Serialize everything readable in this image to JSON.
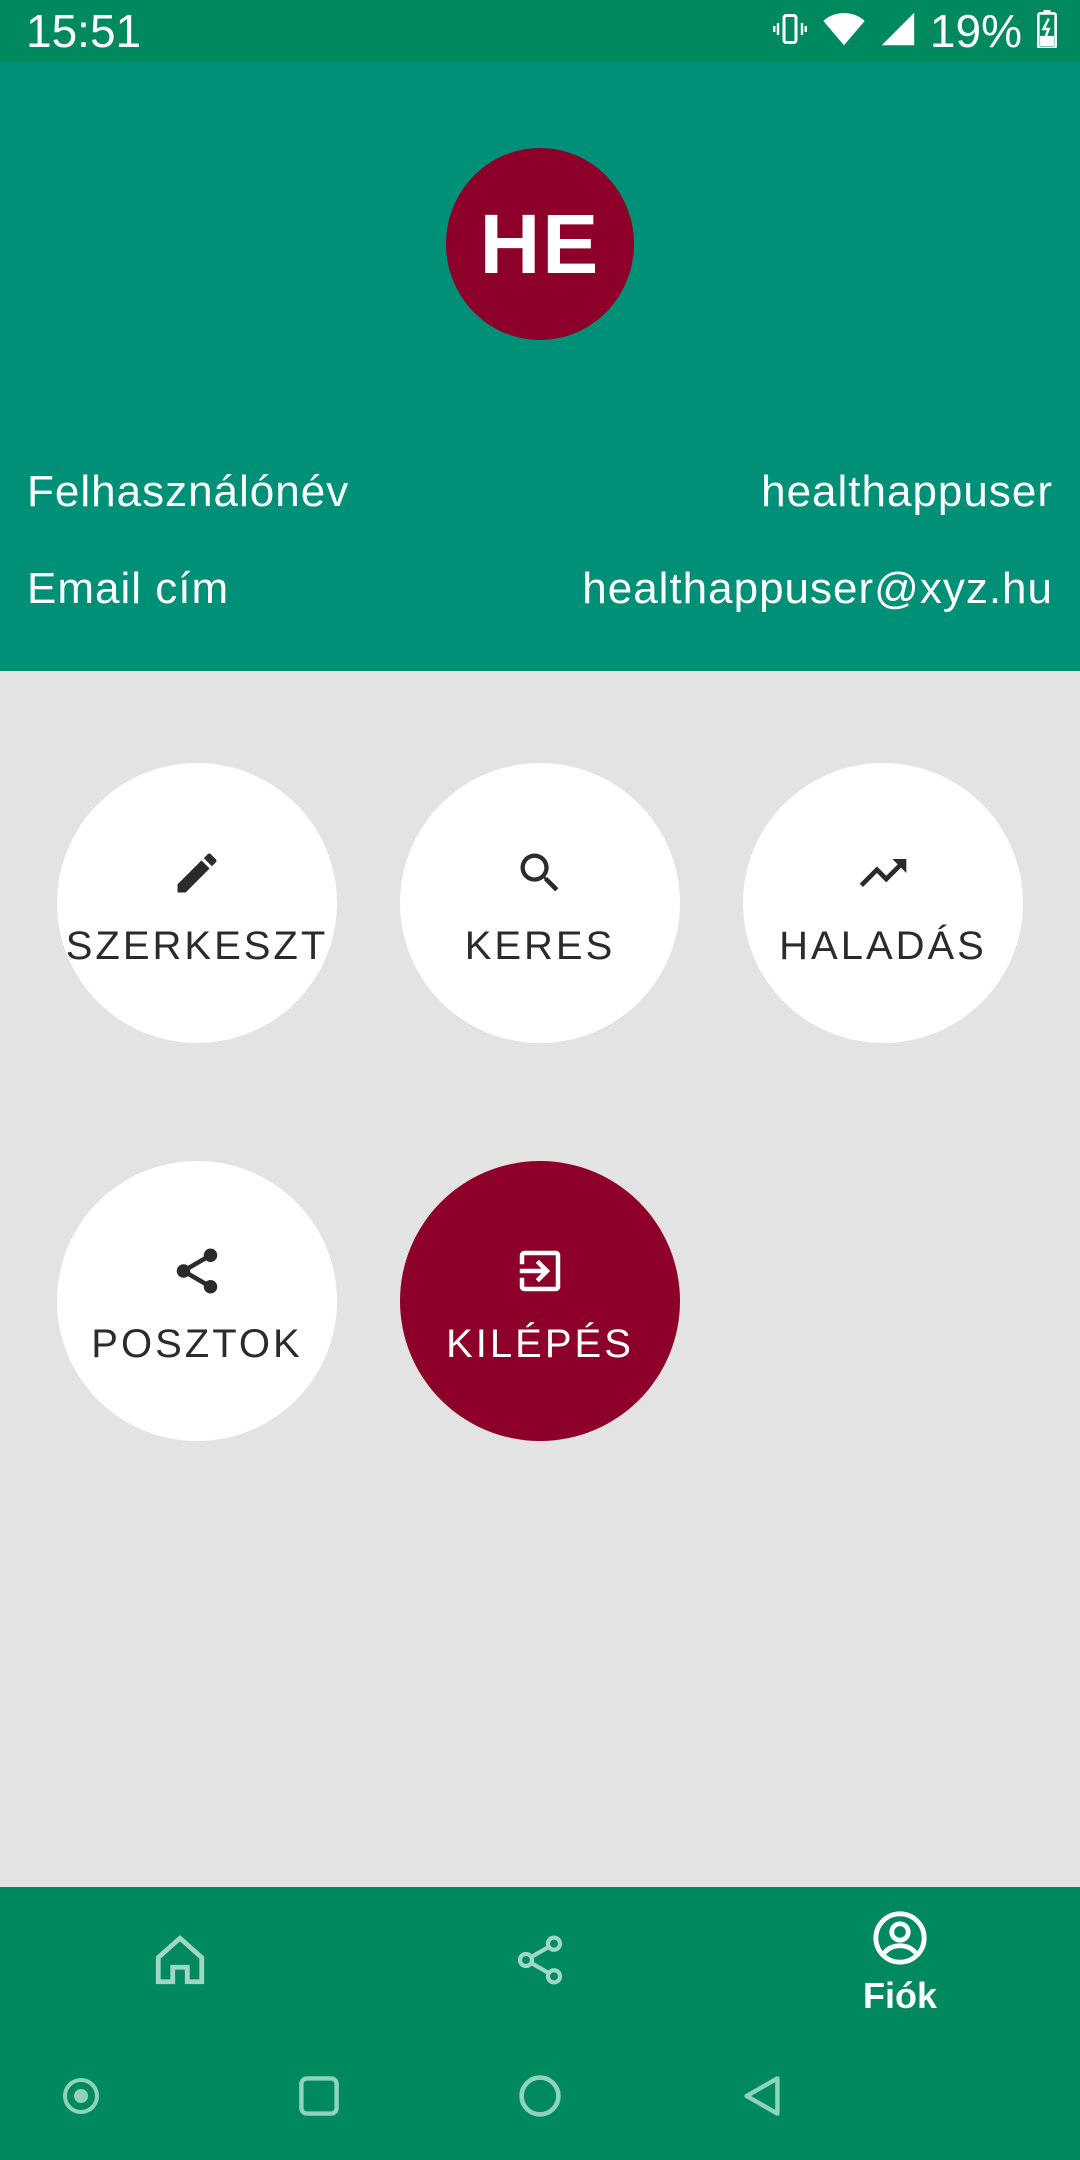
{
  "status_bar": {
    "time": "15:51",
    "battery_percent": "19%",
    "icons": [
      "vibrate-icon",
      "wifi-icon",
      "signal-icon",
      "battery-charging-icon"
    ]
  },
  "profile": {
    "initials": "HE",
    "avatar_color": "#8c0029",
    "username_label": "Felhasználónév",
    "username_value": "healthappuser",
    "email_label": "Email cím",
    "email_value": "healthappuser@xyz.hu"
  },
  "actions": [
    {
      "label": "SZERKESZT",
      "icon": "edit-pencil-icon"
    },
    {
      "label": "KERES",
      "icon": "search-icon"
    },
    {
      "label": "HALADÁS",
      "icon": "trending-up-icon"
    },
    {
      "label": "POSZTOK",
      "icon": "share-icon"
    },
    {
      "label": "KILÉPÉS",
      "icon": "exit-icon"
    }
  ],
  "bottom_nav": {
    "items": [
      {
        "icon": "home-icon",
        "label": ""
      },
      {
        "icon": "share-icon",
        "label": ""
      },
      {
        "icon": "account-icon",
        "label": "Fiók",
        "active": true
      }
    ]
  },
  "system_nav": [
    "dot-icon",
    "recents-square-icon",
    "home-circle-icon",
    "back-triangle-icon"
  ],
  "colors": {
    "status_bar": "#00895f",
    "header": "#009078",
    "accent": "#8c0029",
    "background": "#e3e3e3"
  }
}
